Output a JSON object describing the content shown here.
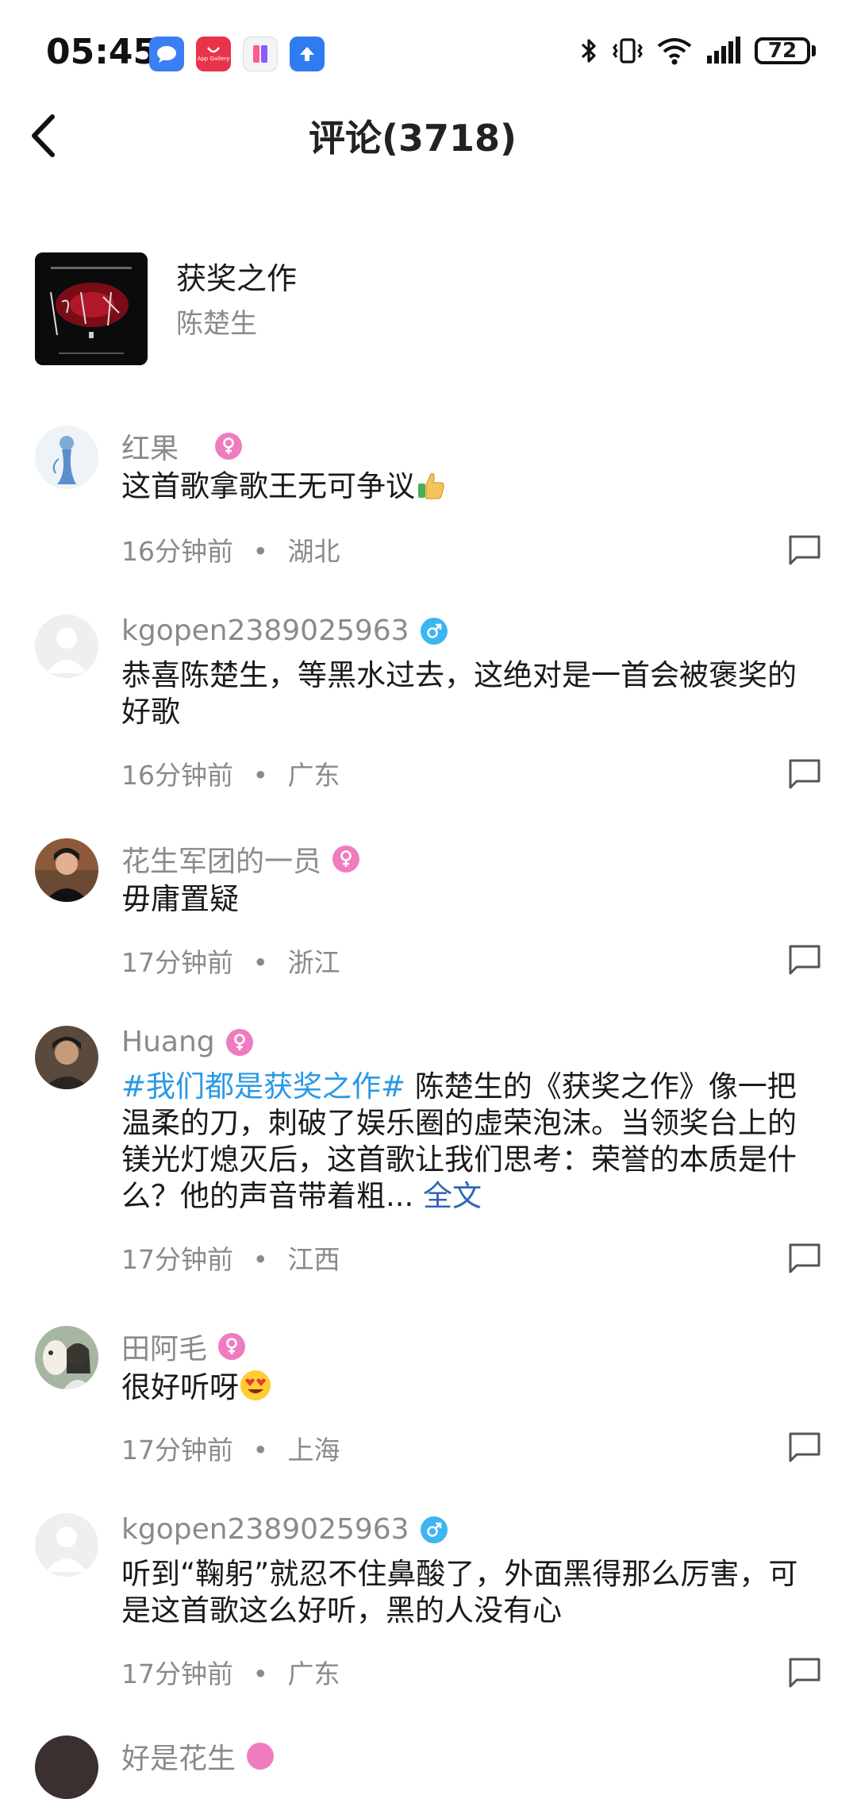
{
  "status_bar": {
    "time": "05:45",
    "battery": "72",
    "notification_icons": [
      "message-icon",
      "app-gallery-icon",
      "app-icon",
      "upload-icon"
    ],
    "app_gallery_label": "App Gallery",
    "system_icons": [
      "bluetooth-icon",
      "vibrate-icon",
      "wifi-icon",
      "signal-icon",
      "battery-icon"
    ]
  },
  "header": {
    "title": "评论(3718)"
  },
  "song": {
    "title": "获奖之作",
    "artist": "陈楚生"
  },
  "comments": [
    {
      "user": "红果",
      "gender": "female",
      "text": "这首歌拿歌王无可争议",
      "emoji": "thumbs-up-icon",
      "time": "16分钟前",
      "location": "湖北"
    },
    {
      "user": "kgopen2389025963",
      "gender": "male",
      "text": "恭喜陈楚生，等黑水过去，这绝对是一首会被褒奖的好歌",
      "time": "16分钟前",
      "location": "广东"
    },
    {
      "user": "花生军团的一员",
      "gender": "female",
      "text": "毋庸置疑",
      "time": "17分钟前",
      "location": "浙江"
    },
    {
      "user": "Huang",
      "gender": "female",
      "topic": "#我们都是获奖之作#",
      "text": " 陈楚生的《获奖之作》像一把温柔的刀，刺破了娱乐圈的虚荣泡沫。当领奖台上的镁光灯熄灭后，这首歌让我们思考：荣誉的本质是什么？他的声音带着粗... ",
      "more": "全文",
      "time": "17分钟前",
      "location": "江西"
    },
    {
      "user": "田阿毛",
      "gender": "female",
      "text": "很好听呀",
      "emoji": "heart-eyes-icon",
      "time": "17分钟前",
      "location": "上海"
    },
    {
      "user": "kgopen2389025963",
      "gender": "male",
      "text": "听到“鞠躬”就忍不住鼻酸了，外面黑得那么厉害，可是这首歌这么好听，黑的人没有心",
      "time": "17分钟前",
      "location": "广东"
    },
    {
      "user": "好是花生",
      "gender": "female"
    }
  ],
  "meta_separator": "•",
  "colors": {
    "topic_blue": "#2a98e6",
    "female_badge": "#f07cc0",
    "male_badge": "#3cb6f0",
    "muted_text": "#8a8a8a"
  }
}
